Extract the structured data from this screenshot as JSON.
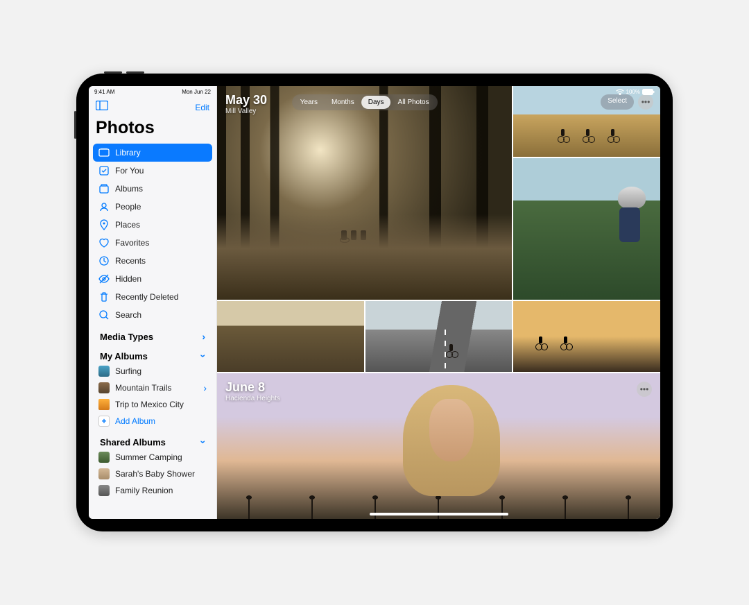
{
  "statusbar": {
    "time": "9:41 AM",
    "date": "Mon Jun 22",
    "battery": "100%"
  },
  "app": {
    "title": "Photos",
    "edit": "Edit"
  },
  "sidebar": {
    "items": [
      {
        "label": "Library"
      },
      {
        "label": "For You"
      },
      {
        "label": "Albums"
      },
      {
        "label": "People"
      },
      {
        "label": "Places"
      },
      {
        "label": "Favorites"
      },
      {
        "label": "Recents"
      },
      {
        "label": "Hidden"
      },
      {
        "label": "Recently Deleted"
      },
      {
        "label": "Search"
      }
    ],
    "sections": {
      "media_types": "Media Types",
      "my_albums": "My Albums",
      "shared_albums": "Shared Albums"
    },
    "my_albums": [
      {
        "label": "Surfing"
      },
      {
        "label": "Mountain Trails"
      },
      {
        "label": "Trip to Mexico City"
      }
    ],
    "add_album": "Add Album",
    "shared": [
      {
        "label": "Summer Camping"
      },
      {
        "label": "Sarah's Baby Shower"
      },
      {
        "label": "Family Reunion"
      }
    ]
  },
  "segments": {
    "years": "Years",
    "months": "Months",
    "days": "Days",
    "all": "All Photos"
  },
  "controls": {
    "select": "Select"
  },
  "groups": [
    {
      "date": "May 30",
      "location": "Mill Valley"
    },
    {
      "date": "June 8",
      "location": "Hacienda Heights"
    }
  ]
}
